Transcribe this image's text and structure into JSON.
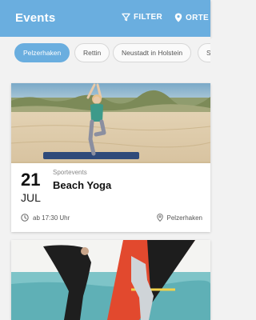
{
  "appbar": {
    "title": "Events",
    "filter_label": "FILTER",
    "orte_label": "ORTE",
    "colors": {
      "primary": "#6aaedf"
    }
  },
  "chips": [
    {
      "label": "Pelzerhaken",
      "active": true
    },
    {
      "label": "Rettin",
      "active": false
    },
    {
      "label": "Neustadt in Holstein",
      "active": false
    },
    {
      "label": "S",
      "active": false
    }
  ],
  "events": [
    {
      "day": "21",
      "month": "JUL",
      "category": "Sportevents",
      "title": "Beach Yoga",
      "time": "ab 17:30 Uhr",
      "location": "Pelzerhaken",
      "image": "beach-yoga-photo"
    },
    {
      "image": "windsurf-photo"
    }
  ]
}
